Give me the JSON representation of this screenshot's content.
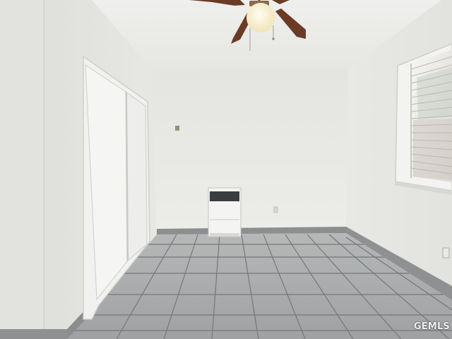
{
  "photo": {
    "subject": "empty-room",
    "watermark": "GEMLS"
  },
  "colors": {
    "wall": "#e6e6e3",
    "ceiling": "#ececea",
    "floor_tile": "#a7a9aa",
    "grout": "#6f7172",
    "fan_blade": "#6b3b26",
    "light_globe": "#fff6da"
  },
  "icons": {
    "fan": "ceiling-fan-icon",
    "heater": "wall-heater-icon",
    "outlet": "wall-outlet-icon"
  }
}
